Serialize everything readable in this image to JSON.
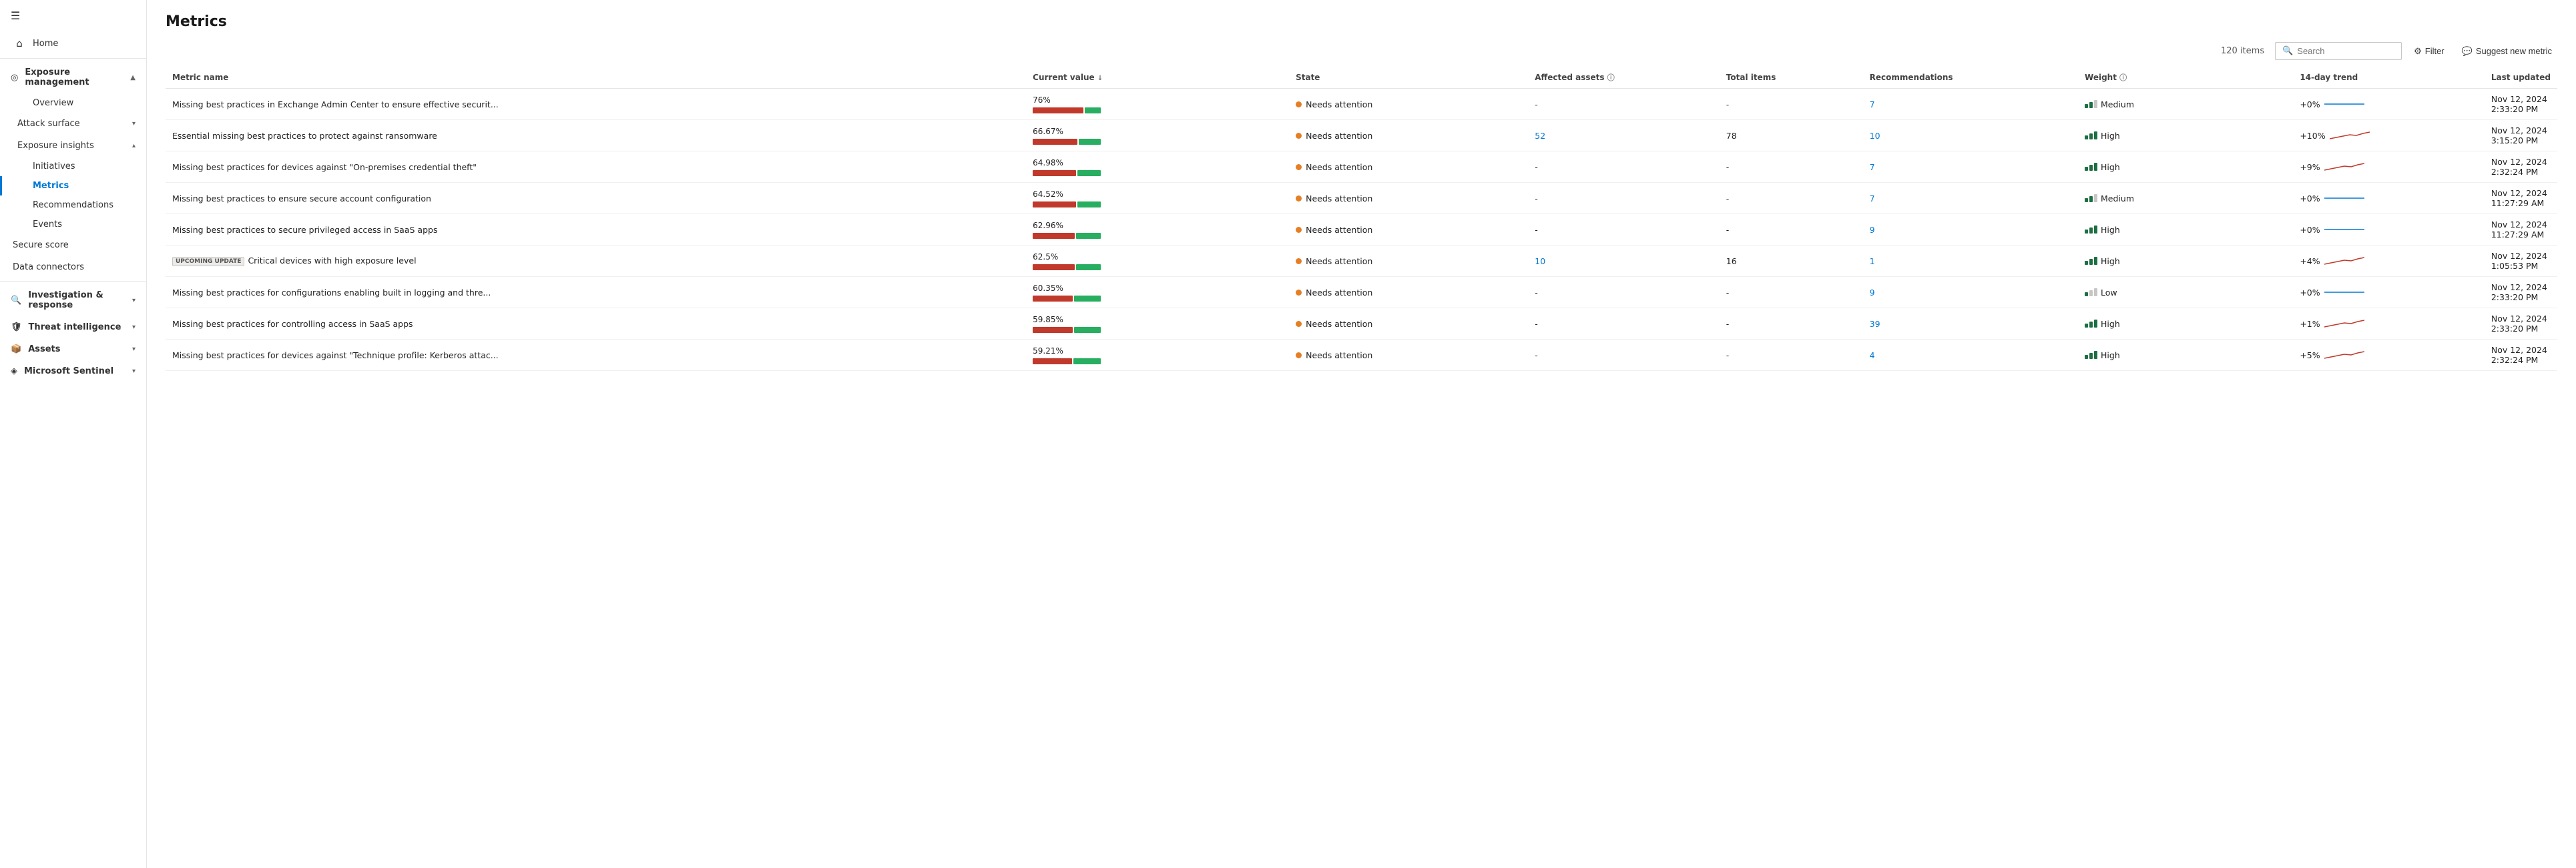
{
  "sidebar": {
    "hamburger": "☰",
    "home_label": "Home",
    "exposure_management": {
      "label": "Exposure management",
      "overview_label": "Overview",
      "attack_surface": {
        "label": "Attack surface"
      },
      "exposure_insights": {
        "label": "Exposure insights",
        "sub_items": [
          {
            "id": "initiatives",
            "label": "Initiatives"
          },
          {
            "id": "metrics",
            "label": "Metrics"
          },
          {
            "id": "recommendations",
            "label": "Recommendations"
          },
          {
            "id": "events",
            "label": "Events"
          }
        ]
      }
    },
    "secure_score": "Secure score",
    "data_connectors": "Data connectors",
    "investigation_response": "Investigation & response",
    "threat_intelligence": "Threat intelligence",
    "assets": "Assets",
    "microsoft_sentinel": "Microsoft Sentinel"
  },
  "page": {
    "title": "Metrics",
    "item_count": "120 items",
    "search_placeholder": "Search",
    "filter_label": "Filter",
    "suggest_label": "Suggest new metric"
  },
  "table": {
    "columns": [
      {
        "id": "name",
        "label": "Metric name"
      },
      {
        "id": "value",
        "label": "Current value",
        "sort": true
      },
      {
        "id": "state",
        "label": "State"
      },
      {
        "id": "affected",
        "label": "Affected assets",
        "info": true
      },
      {
        "id": "total",
        "label": "Total items"
      },
      {
        "id": "recs",
        "label": "Recommendations"
      },
      {
        "id": "weight",
        "label": "Weight",
        "info": true
      },
      {
        "id": "trend",
        "label": "14-day trend"
      },
      {
        "id": "updated",
        "label": "Last updated"
      }
    ],
    "rows": [
      {
        "name": "Missing best practices in Exchange Admin Center to ensure effective securit...",
        "value_pct": "76%",
        "bar_red": 76,
        "bar_green": 24,
        "state": "Needs attention",
        "affected": "-",
        "total": "-",
        "recs": "7",
        "weight": "Medium",
        "weight_level": 2,
        "trend": "+0%",
        "trend_color": "blue",
        "updated": "Nov 12, 2024 2:33:20 PM",
        "upcoming": false
      },
      {
        "name": "Essential missing best practices to protect against ransomware",
        "value_pct": "66.67%",
        "bar_red": 67,
        "bar_green": 33,
        "state": "Needs attention",
        "affected": "52",
        "affected_link": true,
        "total": "78",
        "recs": "10",
        "weight": "High",
        "weight_level": 3,
        "trend": "+10%",
        "trend_color": "red",
        "updated": "Nov 12, 2024 3:15:20 PM",
        "upcoming": false
      },
      {
        "name": "Missing best practices for devices against \"On-premises credential theft\"",
        "value_pct": "64.98%",
        "bar_red": 65,
        "bar_green": 35,
        "state": "Needs attention",
        "affected": "-",
        "total": "-",
        "recs": "7",
        "weight": "High",
        "weight_level": 3,
        "trend": "+9%",
        "trend_color": "red",
        "updated": "Nov 12, 2024 2:32:24 PM",
        "upcoming": false
      },
      {
        "name": "Missing best practices to ensure secure account configuration",
        "value_pct": "64.52%",
        "bar_red": 65,
        "bar_green": 35,
        "state": "Needs attention",
        "affected": "-",
        "total": "-",
        "recs": "7",
        "weight": "Medium",
        "weight_level": 2,
        "trend": "+0%",
        "trend_color": "blue",
        "updated": "Nov 12, 2024 11:27:29 AM",
        "upcoming": false
      },
      {
        "name": "Missing best practices to secure privileged access in SaaS apps",
        "value_pct": "62.96%",
        "bar_red": 63,
        "bar_green": 37,
        "state": "Needs attention",
        "affected": "-",
        "total": "-",
        "recs": "9",
        "weight": "High",
        "weight_level": 3,
        "trend": "+0%",
        "trend_color": "blue",
        "updated": "Nov 12, 2024 11:27:29 AM",
        "upcoming": false
      },
      {
        "name": "Critical devices with high exposure level",
        "value_pct": "62.5%",
        "bar_red": 63,
        "bar_green": 37,
        "state": "Needs attention",
        "affected": "10",
        "affected_link": true,
        "total": "16",
        "recs": "1",
        "weight": "High",
        "weight_level": 3,
        "trend": "+4%",
        "trend_color": "red",
        "updated": "Nov 12, 2024 1:05:53 PM",
        "upcoming": true
      },
      {
        "name": "Missing best practices for configurations enabling built in logging and thre...",
        "value_pct": "60.35%",
        "bar_red": 60,
        "bar_green": 40,
        "state": "Needs attention",
        "affected": "-",
        "total": "-",
        "recs": "9",
        "weight": "Low",
        "weight_level": 1,
        "trend": "+0%",
        "trend_color": "blue",
        "updated": "Nov 12, 2024 2:33:20 PM",
        "upcoming": false
      },
      {
        "name": "Missing best practices for controlling access in SaaS apps",
        "value_pct": "59.85%",
        "bar_red": 60,
        "bar_green": 40,
        "state": "Needs attention",
        "affected": "-",
        "total": "-",
        "recs": "39",
        "weight": "High",
        "weight_level": 3,
        "trend": "+1%",
        "trend_color": "red",
        "updated": "Nov 12, 2024 2:33:20 PM",
        "upcoming": false
      },
      {
        "name": "Missing best practices for devices against \"Technique profile: Kerberos attac...",
        "value_pct": "59.21%",
        "bar_red": 59,
        "bar_green": 41,
        "state": "Needs attention",
        "affected": "-",
        "total": "-",
        "recs": "4",
        "weight": "High",
        "weight_level": 3,
        "trend": "+5%",
        "trend_color": "red",
        "updated": "Nov 12, 2024 2:32:24 PM",
        "upcoming": false
      }
    ]
  }
}
